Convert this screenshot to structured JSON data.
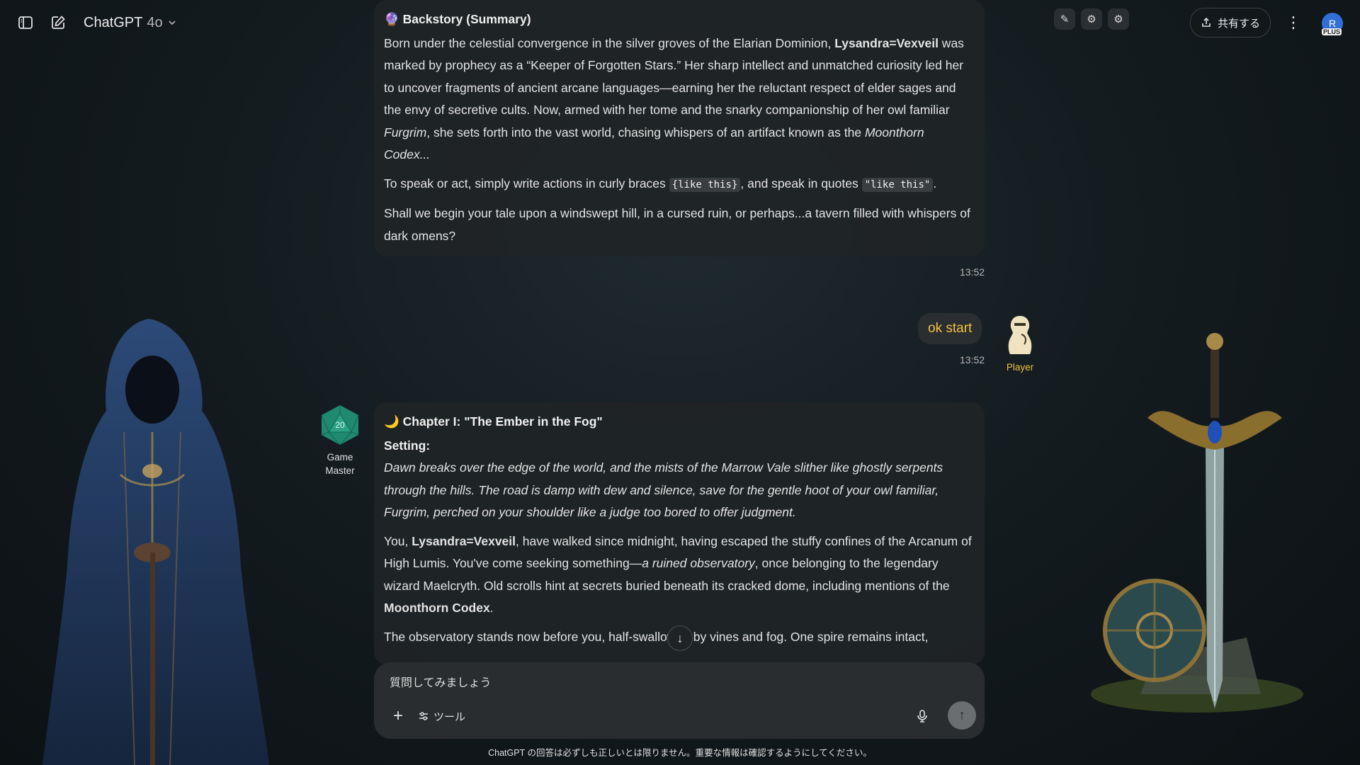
{
  "header": {
    "model_name": "ChatGPT",
    "model_version": "4o",
    "share_label": "共有する",
    "avatar_initial": "R",
    "plan_badge": "PLUS",
    "extension_icons": [
      "feather-icon",
      "gear-icon",
      "gear-icon"
    ]
  },
  "messages": {
    "backstory": {
      "heading_emoji": "🔮",
      "heading": "Backstory (Summary)",
      "p1_a": "Born under the celestial convergence in the silver groves of the Elarian Dominion, ",
      "p1_name": "Lysandra=Vexveil",
      "p1_b": " was marked by prophecy as a “Keeper of Forgotten Stars.” Her sharp intellect and unmatched curiosity led her to uncover fragments of ancient arcane languages—earning her the reluctant respect of elder sages and the envy of secretive cults. Now, armed with her tome and the snarky companionship of her owl familiar ",
      "p1_owl": "Furgrim",
      "p1_c": ", she sets forth into the vast world, chasing whispers of an artifact known as the ",
      "p1_codex": "Moonthorn Codex...",
      "p2_a": "To speak or act, simply write actions in curly braces ",
      "p2_code1": "{like this}",
      "p2_b": ", and speak in quotes ",
      "p2_code2": "\"like this\"",
      "p2_c": ".",
      "p3": "Shall we begin your tale upon a windswept hill, in a cursed ruin, or perhaps...a tavern filled with whispers of dark omens?",
      "time": "13:52"
    },
    "user": {
      "text": "ok start",
      "time": "13:52",
      "label": "Player"
    },
    "chapter": {
      "gm_label_line1": "Game",
      "gm_label_line2": "Master",
      "die_value": "20",
      "heading_emoji": "🌙",
      "heading": "Chapter I: \"The Ember in the Fog\"",
      "setting_label": "Setting:",
      "setting_text": "Dawn breaks over the edge of the world, and the mists of the Marrow Vale slither like ghostly serpents through the hills. The road is damp with dew and silence, save for the gentle hoot of your owl familiar, Furgrim, perched on your shoulder like a judge too bored to offer judgment.",
      "p2_a": "You, ",
      "p2_name": "Lysandra=Vexveil",
      "p2_b": ", have walked since midnight, having escaped the stuffy confines of the Arcanum of High Lumis. You've come seeking something—",
      "p2_italic": "a ruined observatory",
      "p2_c": ", once belonging to the legendary wizard Maelcryth. Old scrolls hint at secrets buried beneath its cracked dome, including mentions of the ",
      "p2_codex": "Moonthorn Codex",
      "p2_d": ".",
      "p3": "The observatory stands now before you, half-swallowed by vines and fog. One spire remains intact,"
    }
  },
  "composer": {
    "placeholder": "質問してみましょう",
    "tools_label": "ツール"
  },
  "disclaimer": "ChatGPT の回答は必ずしも正しいとは限りません。重要な情報は確認するようにしてください。",
  "colors": {
    "accent_user_text": "#f0c040",
    "gm_die": "#1f8a6e",
    "avatar": "#2f6fd6"
  }
}
